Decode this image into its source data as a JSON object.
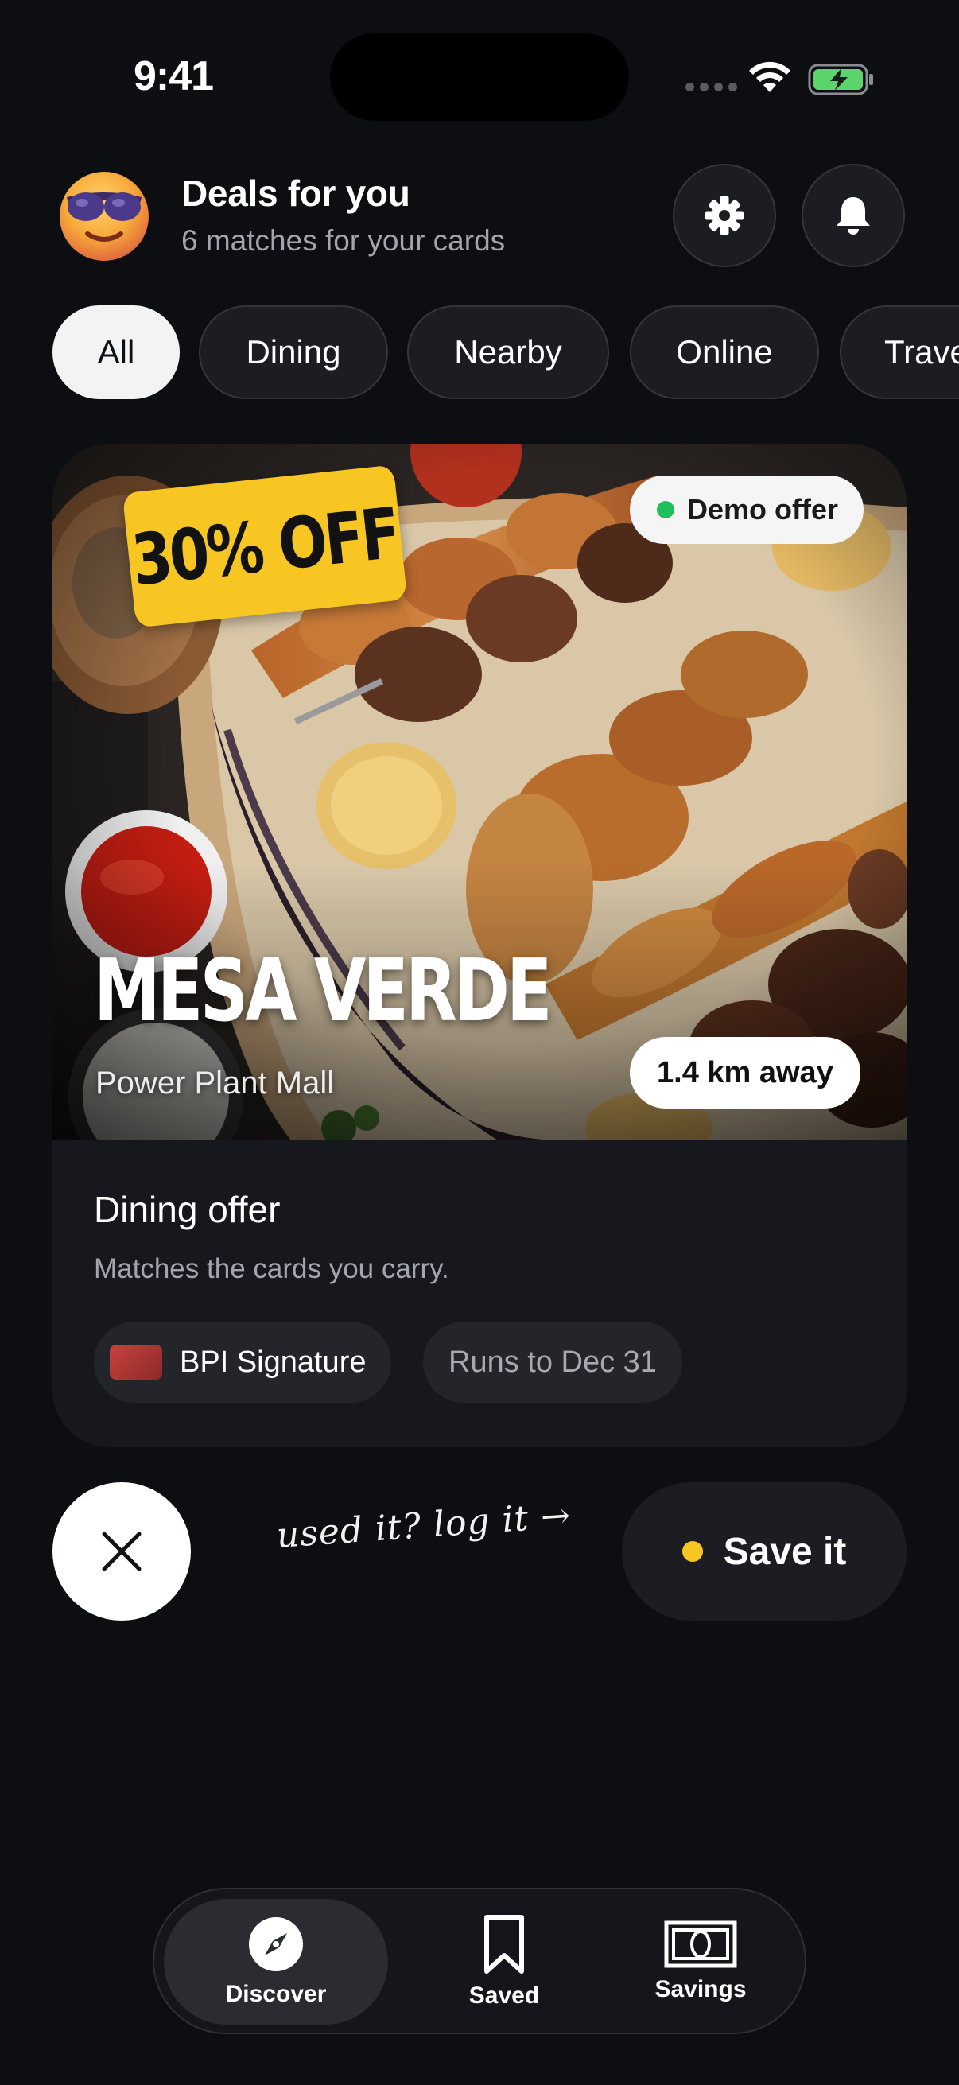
{
  "status_bar": {
    "time": "9:41"
  },
  "header": {
    "title": "Deals for you",
    "subtitle": "6 matches for your cards"
  },
  "filters": [
    {
      "label": "All",
      "active": true
    },
    {
      "label": "Dining",
      "active": false
    },
    {
      "label": "Nearby",
      "active": false
    },
    {
      "label": "Online",
      "active": false
    },
    {
      "label": "Travel",
      "active": false
    }
  ],
  "deal": {
    "discount": "30% OFF",
    "badge": "Demo offer",
    "merchant": "MESA VERDE",
    "location": "Power Plant Mall",
    "distance": "1.4 km away",
    "offer_title": "Dining offer",
    "offer_subtitle": "Matches the cards you carry.",
    "card_name": "BPI Signature",
    "validity": "Runs to Dec 31"
  },
  "actions": {
    "hint": "used it? log it →",
    "save_label": "Save it"
  },
  "tabs": [
    {
      "label": "Discover",
      "icon": "compass-icon",
      "active": true
    },
    {
      "label": "Saved",
      "icon": "bookmark-icon",
      "active": false
    },
    {
      "label": "Savings",
      "icon": "banknote-icon",
      "active": false
    }
  ],
  "colors": {
    "background": "#0d0e12",
    "accent_yellow": "#f7c623",
    "demo_green": "#1fbf5b"
  }
}
